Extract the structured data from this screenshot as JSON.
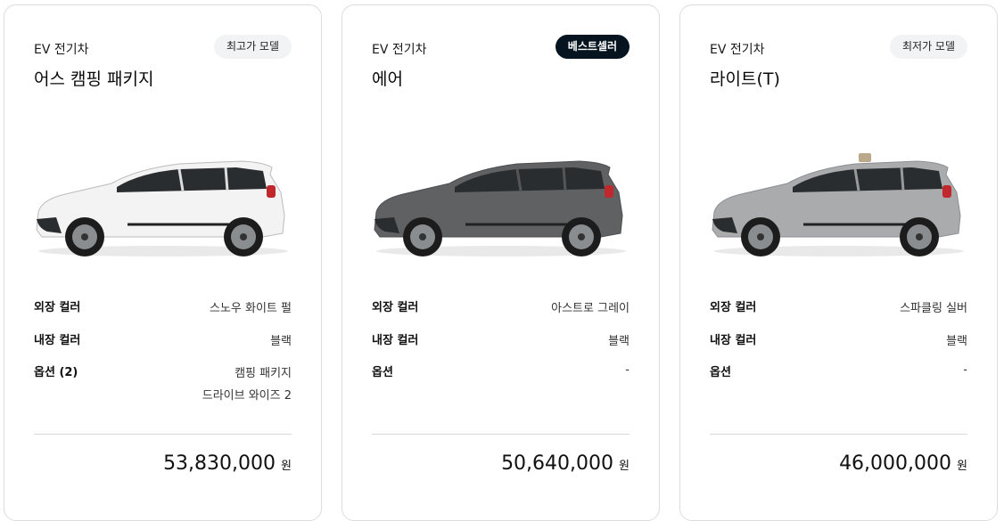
{
  "cards": [
    {
      "category": "EV 전기차",
      "badge": "최고가 모델",
      "model": "어스 캠핑 패키지",
      "car_color": "#f3f3f3",
      "specs": {
        "exterior_label": "외장 컬러",
        "exterior_value": "스노우 화이트 펄",
        "interior_label": "내장 컬러",
        "interior_value": "블랙",
        "option_label": "옵션 (2)",
        "option_value_1": "캠핑 패키지",
        "option_value_2": "드라이브 와이즈 2"
      },
      "price": "53,830,000",
      "currency": "원"
    },
    {
      "category": "EV 전기차",
      "badge": "베스트셀러",
      "model": "에어",
      "car_color": "#5f6163",
      "specs": {
        "exterior_label": "외장 컬러",
        "exterior_value": "아스트로 그레이",
        "interior_label": "내장 컬러",
        "interior_value": "블랙",
        "option_label": "옵션",
        "option_value_1": "-"
      },
      "price": "50,640,000",
      "currency": "원"
    },
    {
      "category": "EV 전기차",
      "badge": "최저가 모델",
      "model": "라이트(T)",
      "car_color": "#a9abad",
      "specs": {
        "exterior_label": "외장 컬러",
        "exterior_value": "스파클링 실버",
        "interior_label": "내장 컬러",
        "interior_value": "블랙",
        "option_label": "옵션",
        "option_value_1": "-"
      },
      "price": "46,000,000",
      "currency": "원"
    }
  ]
}
